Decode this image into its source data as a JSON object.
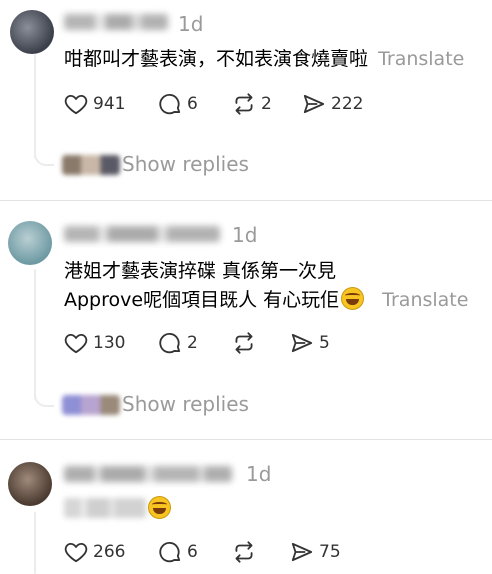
{
  "posts": [
    {
      "username": "",
      "time": "1d",
      "lines": [
        "咁都叫才藝表演，不如表演食燒賣啦"
      ],
      "translate": "Translate",
      "counts": {
        "likes": "941",
        "comments": "6",
        "reposts": "2",
        "shares": "222"
      },
      "show_replies": "Show replies",
      "colors": {
        "avatar": [
          "#3a3f4a",
          "#8a8f99"
        ],
        "username": "#9c9c9c",
        "replies": [
          "#8a7a6a",
          "#c9b8a8",
          "#5a5a66"
        ]
      }
    },
    {
      "username": "",
      "time": "1d",
      "lines": [
        "港姐才藝表演捽碟 真係第一次見",
        "Approve呢個項目既人 有心玩佢"
      ],
      "translate": "Translate",
      "counts": {
        "likes": "130",
        "comments": "2",
        "reposts": "",
        "shares": "5"
      },
      "show_replies": "Show replies",
      "colors": {
        "avatar": [
          "#6e9aa3",
          "#b9cfd3"
        ],
        "username": "#9c9c9c",
        "replies": [
          "#8f8fd6",
          "#b8a4d0",
          "#9a8a7a"
        ]
      }
    },
    {
      "username": "",
      "time": "1d",
      "lines": [
        ""
      ],
      "translate": "",
      "counts": {
        "likes": "266",
        "comments": "6",
        "reposts": "",
        "shares": "75"
      },
      "show_replies": "",
      "colors": {
        "avatar": [
          "#4a3a30",
          "#a08a7a"
        ],
        "username": "#9c9c9c",
        "replies": []
      }
    }
  ],
  "icons": {
    "like": "heart-icon",
    "comment": "comment-bubble-icon",
    "repost": "repost-icon",
    "share": "send-icon",
    "emoji": "laughing-tears-emoji"
  }
}
